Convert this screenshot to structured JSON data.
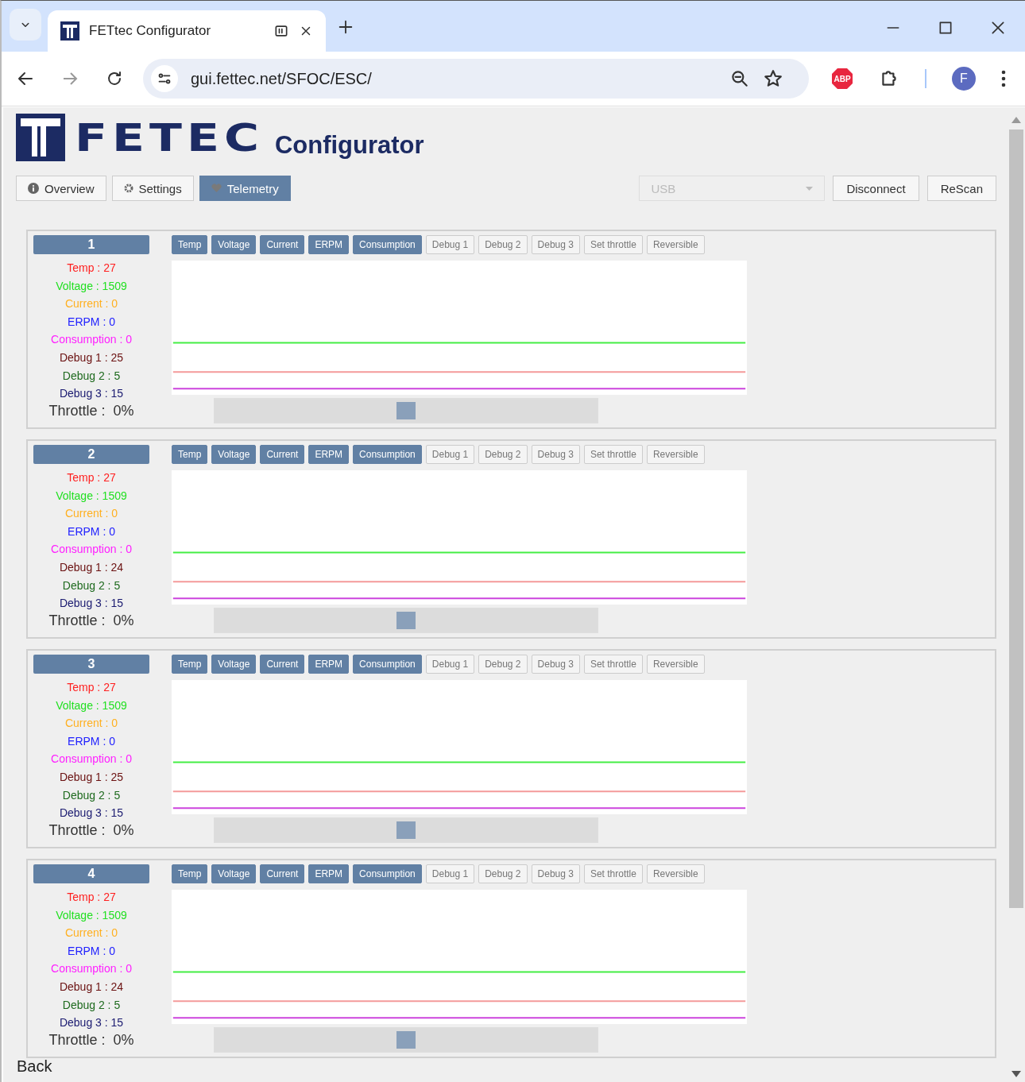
{
  "browser": {
    "tab_title": "FETtec Configurator",
    "url": "gui.fettec.net/SFOC/ESC/",
    "profile_initial": "F",
    "extension_label": "ABP"
  },
  "header": {
    "logo_text": "FETEC",
    "title": "Configurator"
  },
  "nav": [
    {
      "label": "Overview",
      "kind": "info",
      "selected": false
    },
    {
      "label": "Settings",
      "kind": "gear",
      "selected": false
    },
    {
      "label": "Telemetry",
      "kind": "heart",
      "selected": true
    }
  ],
  "port_select": {
    "value": "USB",
    "disabled": true
  },
  "buttons": [
    "Disconnect",
    "ReScan"
  ],
  "escs": [
    {
      "number": "1",
      "toggles": [
        {
          "label": "Temp",
          "selected": true
        },
        {
          "label": "Voltage",
          "selected": true
        },
        {
          "label": "Current",
          "selected": true
        },
        {
          "label": "ERPM",
          "selected": true
        },
        {
          "label": "Consumption",
          "selected": true
        },
        {
          "label": "Debug 1",
          "selected": false
        },
        {
          "label": "Debug 2",
          "selected": false
        },
        {
          "label": "Debug 3",
          "selected": false
        },
        {
          "label": "Set throttle",
          "selected": false
        },
        {
          "label": "Reversible",
          "selected": false
        }
      ],
      "readouts": [
        {
          "text": "Temp : 27",
          "color": "#ff2020"
        },
        {
          "text": "Voltage : 1509",
          "color": "#22e022"
        },
        {
          "text": "Current : 0",
          "color": "#ffb020"
        },
        {
          "text": "ERPM : 0",
          "color": "#2020ff"
        },
        {
          "text": "Consumption : 0",
          "color": "#ff20ff"
        },
        {
          "text": "Debug 1 : 25",
          "color": "#6a1010"
        },
        {
          "text": "Debug 2 : 5",
          "color": "#1e6a1e"
        },
        {
          "text": "Debug 3 : 15",
          "color": "#1a1a70"
        }
      ],
      "throttle": "Throttle :  0%",
      "level": 0.5
    },
    {
      "number": "2",
      "toggles": [
        {
          "label": "Temp",
          "selected": true
        },
        {
          "label": "Voltage",
          "selected": true
        },
        {
          "label": "Current",
          "selected": true
        },
        {
          "label": "ERPM",
          "selected": true
        },
        {
          "label": "Consumption",
          "selected": true
        },
        {
          "label": "Debug 1",
          "selected": false
        },
        {
          "label": "Debug 2",
          "selected": false
        },
        {
          "label": "Debug 3",
          "selected": false
        },
        {
          "label": "Set throttle",
          "selected": false
        },
        {
          "label": "Reversible",
          "selected": false
        }
      ],
      "readouts": [
        {
          "text": "Temp : 27",
          "color": "#ff2020"
        },
        {
          "text": "Voltage : 1509",
          "color": "#22e022"
        },
        {
          "text": "Current : 0",
          "color": "#ffb020"
        },
        {
          "text": "ERPM : 0",
          "color": "#2020ff"
        },
        {
          "text": "Consumption : 0",
          "color": "#ff20ff"
        },
        {
          "text": "Debug 1 : 24",
          "color": "#6a1010"
        },
        {
          "text": "Debug 2 : 5",
          "color": "#1e6a1e"
        },
        {
          "text": "Debug 3 : 15",
          "color": "#1a1a70"
        }
      ],
      "throttle": "Throttle :  0%",
      "level": 0.5
    },
    {
      "number": "3",
      "toggles": [
        {
          "label": "Temp",
          "selected": true
        },
        {
          "label": "Voltage",
          "selected": true
        },
        {
          "label": "Current",
          "selected": true
        },
        {
          "label": "ERPM",
          "selected": true
        },
        {
          "label": "Consumption",
          "selected": true
        },
        {
          "label": "Debug 1",
          "selected": false
        },
        {
          "label": "Debug 2",
          "selected": false
        },
        {
          "label": "Debug 3",
          "selected": false
        },
        {
          "label": "Set throttle",
          "selected": false
        },
        {
          "label": "Reversible",
          "selected": false
        }
      ],
      "readouts": [
        {
          "text": "Temp : 27",
          "color": "#ff2020"
        },
        {
          "text": "Voltage : 1509",
          "color": "#22e022"
        },
        {
          "text": "Current : 0",
          "color": "#ffb020"
        },
        {
          "text": "ERPM : 0",
          "color": "#2020ff"
        },
        {
          "text": "Consumption : 0",
          "color": "#ff20ff"
        },
        {
          "text": "Debug 1 : 25",
          "color": "#6a1010"
        },
        {
          "text": "Debug 2 : 5",
          "color": "#1e6a1e"
        },
        {
          "text": "Debug 3 : 15",
          "color": "#1a1a70"
        }
      ],
      "throttle": "Throttle :  0%",
      "level": 0.5
    },
    {
      "number": "4",
      "toggles": [
        {
          "label": "Temp",
          "selected": true
        },
        {
          "label": "Voltage",
          "selected": true
        },
        {
          "label": "Current",
          "selected": true
        },
        {
          "label": "ERPM",
          "selected": true
        },
        {
          "label": "Consumption",
          "selected": true
        },
        {
          "label": "Debug 1",
          "selected": false
        },
        {
          "label": "Debug 2",
          "selected": false
        },
        {
          "label": "Debug 3",
          "selected": false
        },
        {
          "label": "Set throttle",
          "selected": false
        },
        {
          "label": "Reversible",
          "selected": false
        }
      ],
      "readouts": [
        {
          "text": "Temp : 27",
          "color": "#ff2020"
        },
        {
          "text": "Voltage : 1509",
          "color": "#22e022"
        },
        {
          "text": "Current : 0",
          "color": "#ffb020"
        },
        {
          "text": "ERPM : 0",
          "color": "#2020ff"
        },
        {
          "text": "Consumption : 0",
          "color": "#ff20ff"
        },
        {
          "text": "Debug 1 : 24",
          "color": "#6a1010"
        },
        {
          "text": "Debug 2 : 5",
          "color": "#1e6a1e"
        },
        {
          "text": "Debug 3 : 15",
          "color": "#1a1a70"
        }
      ],
      "throttle": "Throttle :  0%",
      "level": 0.5
    }
  ],
  "back_link": "Back"
}
